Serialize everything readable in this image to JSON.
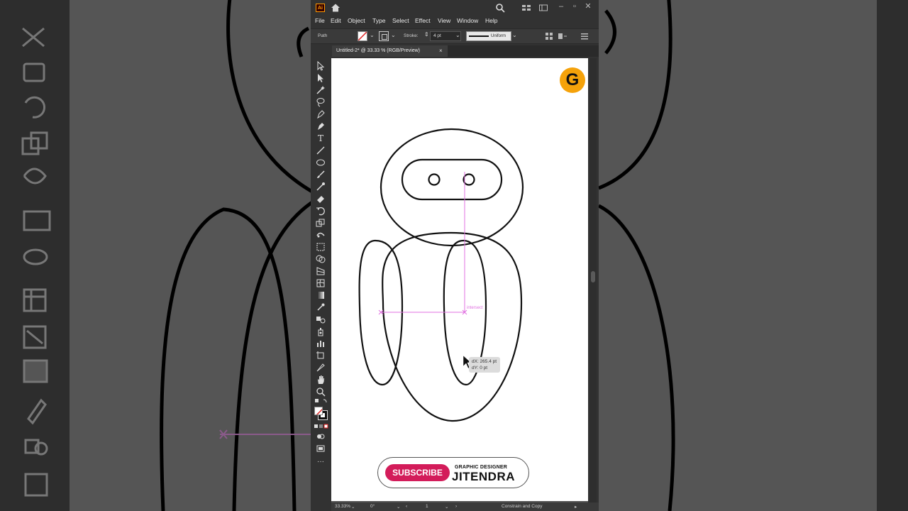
{
  "app": {
    "logo": "Ai",
    "home_icon": "home-icon",
    "search_icon": "search-icon"
  },
  "menu": [
    "File",
    "Edit",
    "Object",
    "Type",
    "Select",
    "Effect",
    "View",
    "Window",
    "Help"
  ],
  "control_bar": {
    "selection_label": "Path",
    "stroke_label": "Stroke:",
    "stroke_value": "4 pt",
    "profile_value": "Uniform"
  },
  "document": {
    "tab_title": "Untitled-2* @ 33.33 % (RGB/Preview)",
    "close_glyph": "×"
  },
  "canvas": {
    "intersect_hint": "intersect",
    "tooltip_dx": "dX: 265.4 pt",
    "tooltip_dy": "dY: 0 pt"
  },
  "overlay": {
    "logo_letter": "G",
    "subscribe_label": "SUBSCRIBE",
    "channel_tagline": "GRAPHIC DESIGNER",
    "channel_name": "JITENDRA"
  },
  "status_bar": {
    "zoom": "33.33%",
    "rotation": "0°",
    "artboard_number": "1",
    "tool_status": "Constrain and Copy"
  },
  "colors": {
    "accent_orange": "#f5a20a",
    "subscribe_red": "#d31c5a",
    "smart_guide_magenta": "#e070e0"
  }
}
